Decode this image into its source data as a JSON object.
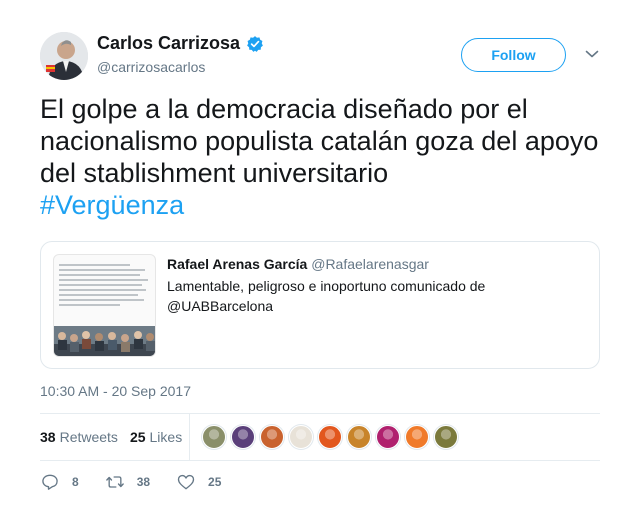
{
  "author": {
    "name": "Carlos Carrizosa",
    "handle": "@carrizosacarlos",
    "verified": true
  },
  "follow_label": "Follow",
  "tweet": {
    "text": "El golpe a la democracia diseñado por el nacionalismo populista catalán goza del apoyo del stablishment universitario",
    "hashtag": "#Vergüenza"
  },
  "quoted": {
    "name": "Rafael Arenas García",
    "handle": "@Rafaelarenasgar",
    "text": "Lamentable, peligroso e inoportuno comunicado de @UABBarcelona"
  },
  "timestamp": "10:30 AM - 20 Sep 2017",
  "stats": {
    "retweets_count": "38",
    "retweets_label": "Retweets",
    "likes_count": "25",
    "likes_label": "Likes"
  },
  "likers": [
    {
      "color": "#8a8f6a"
    },
    {
      "color": "#5a3f7a"
    },
    {
      "color": "#c9622e"
    },
    {
      "color": "#e8e2d8"
    },
    {
      "color": "#e2571e"
    },
    {
      "color": "#c8842a"
    },
    {
      "color": "#b0206e"
    },
    {
      "color": "#f07a2a"
    },
    {
      "color": "#7b7a3c"
    }
  ],
  "actions": {
    "reply_count": "8",
    "retweet_count": "38",
    "like_count": "25"
  },
  "colors": {
    "accent": "#1da1f2",
    "secondary_text": "#657786",
    "border": "#e6ecf0"
  }
}
